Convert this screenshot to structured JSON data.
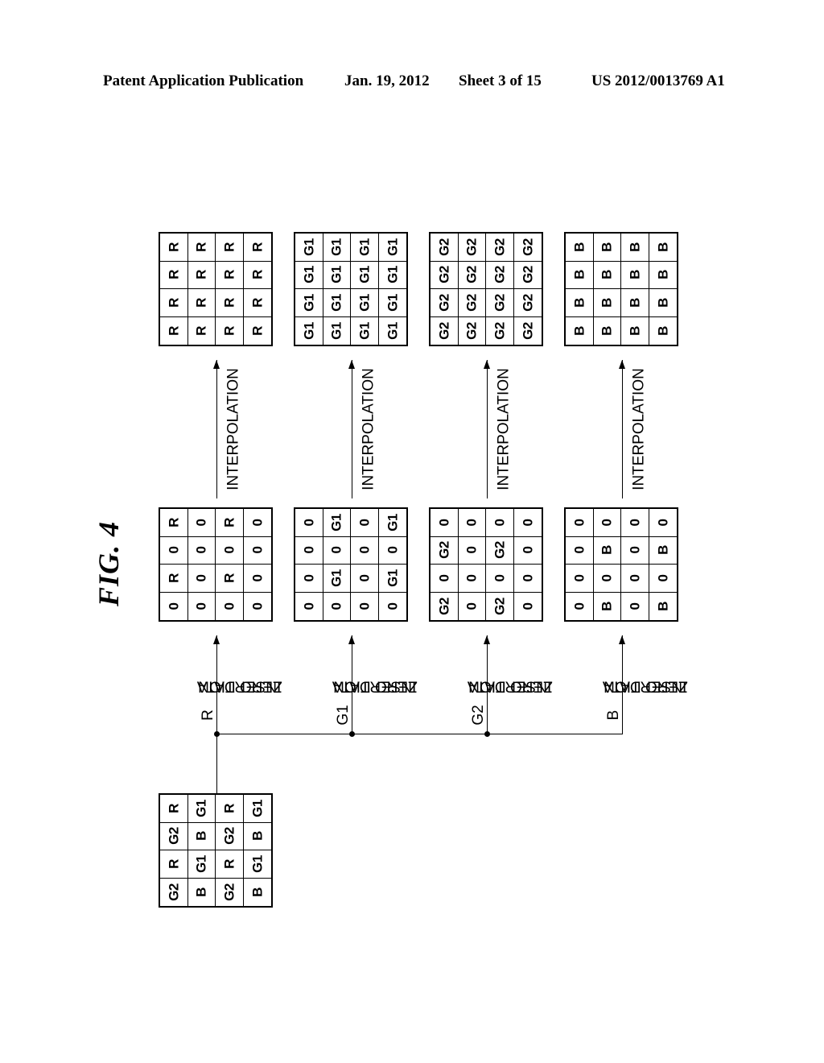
{
  "header": {
    "publication": "Patent Application Publication",
    "date": "Jan. 19, 2012",
    "sheet": "Sheet 3 of 15",
    "number": "US 2012/0013769 A1"
  },
  "figure": {
    "label": "FIG. 4"
  },
  "labels": {
    "interpolation": "INTERPOLATION",
    "zero_data_insertion_line1": "ZERO DATA",
    "zero_data_insertion_line2": "INSERTION"
  },
  "channels": [
    {
      "key": "r",
      "label": "R"
    },
    {
      "key": "g1",
      "label": "G1"
    },
    {
      "key": "g2",
      "label": "G2"
    },
    {
      "key": "b",
      "label": "B"
    }
  ],
  "grids": {
    "source": {
      "name": "source-mosaic",
      "rows": 4,
      "cols": 4,
      "cells": [
        [
          "G1",
          "B",
          "G1",
          "B"
        ],
        [
          "R",
          "G2",
          "R",
          "G2"
        ],
        [
          "G1",
          "B",
          "G1",
          "B"
        ],
        [
          "R",
          "G2",
          "R",
          "G2"
        ]
      ]
    },
    "zero_r": {
      "name": "zero-inserted-r",
      "cells": [
        [
          "0",
          "0",
          "0",
          "0"
        ],
        [
          "R",
          "0",
          "R",
          "0"
        ],
        [
          "0",
          "0",
          "0",
          "0"
        ],
        [
          "R",
          "0",
          "R",
          "0"
        ]
      ]
    },
    "zero_g1": {
      "name": "zero-inserted-g1",
      "cells": [
        [
          "G1",
          "0",
          "G1",
          "0"
        ],
        [
          "0",
          "0",
          "0",
          "0"
        ],
        [
          "G1",
          "0",
          "G1",
          "0"
        ],
        [
          "0",
          "0",
          "0",
          "0"
        ]
      ]
    },
    "zero_g2": {
      "name": "zero-inserted-g2",
      "cells": [
        [
          "0",
          "0",
          "0",
          "0"
        ],
        [
          "0",
          "G2",
          "0",
          "G2"
        ],
        [
          "0",
          "0",
          "0",
          "0"
        ],
        [
          "0",
          "G2",
          "0",
          "G2"
        ]
      ]
    },
    "zero_b": {
      "name": "zero-inserted-b",
      "cells": [
        [
          "0",
          "B",
          "0",
          "B"
        ],
        [
          "0",
          "0",
          "0",
          "0"
        ],
        [
          "0",
          "B",
          "0",
          "B"
        ],
        [
          "0",
          "0",
          "0",
          "0"
        ]
      ]
    },
    "interp_r": {
      "name": "interpolated-r",
      "cells": [
        [
          "R",
          "R",
          "R",
          "R"
        ],
        [
          "R",
          "R",
          "R",
          "R"
        ],
        [
          "R",
          "R",
          "R",
          "R"
        ],
        [
          "R",
          "R",
          "R",
          "R"
        ]
      ]
    },
    "interp_g1": {
      "name": "interpolated-g1",
      "cells": [
        [
          "G1",
          "G1",
          "G1",
          "G1"
        ],
        [
          "G1",
          "G1",
          "G1",
          "G1"
        ],
        [
          "G1",
          "G1",
          "G1",
          "G1"
        ],
        [
          "G1",
          "G1",
          "G1",
          "G1"
        ]
      ]
    },
    "interp_g2": {
      "name": "interpolated-g2",
      "cells": [
        [
          "G2",
          "G2",
          "G2",
          "G2"
        ],
        [
          "G2",
          "G2",
          "G2",
          "G2"
        ],
        [
          "G2",
          "G2",
          "G2",
          "G2"
        ],
        [
          "G2",
          "G2",
          "G2",
          "G2"
        ]
      ]
    },
    "interp_b": {
      "name": "interpolated-b",
      "cells": [
        [
          "B",
          "B",
          "B",
          "B"
        ],
        [
          "B",
          "B",
          "B",
          "B"
        ],
        [
          "B",
          "B",
          "B",
          "B"
        ],
        [
          "B",
          "B",
          "B",
          "B"
        ]
      ]
    }
  },
  "colors": {
    "ink": "#000000",
    "paper": "#ffffff"
  }
}
